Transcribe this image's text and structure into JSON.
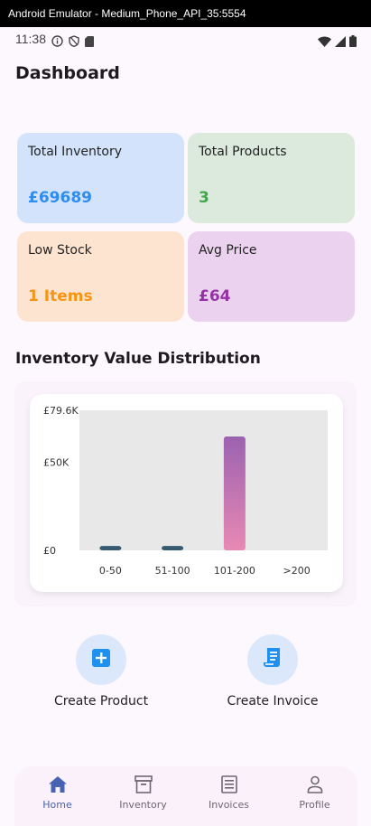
{
  "window": {
    "title": "Android Emulator - Medium_Phone_API_35:5554"
  },
  "status_bar": {
    "time": "11:38"
  },
  "page": {
    "title": "Dashboard"
  },
  "stats": [
    {
      "label": "Total Inventory",
      "value": "£69689",
      "bg": "#d3e3fc",
      "color": "#2f8df0"
    },
    {
      "label": "Total Products",
      "value": "3",
      "bg": "#dbeadc",
      "color": "#3ea94a"
    },
    {
      "label": "Low Stock",
      "value": "1 Items",
      "bg": "#fde4d1",
      "color": "#f79513"
    },
    {
      "label": "Avg Price",
      "value": "£64",
      "bg": "#ebd2ee",
      "color": "#9631a8"
    }
  ],
  "chart_section": {
    "title": "Inventory Value Distribution"
  },
  "chart_data": {
    "type": "bar",
    "categories": [
      "0-50",
      "51-100",
      "101-200",
      ">200"
    ],
    "values": [
      2500,
      2500,
      64689,
      0
    ],
    "ylim": [
      0,
      79600
    ],
    "yticks": [
      {
        "value": 0,
        "label": "£0"
      },
      {
        "value": 50000,
        "label": "£50K"
      },
      {
        "value": 79600,
        "label": "£79.6K"
      }
    ],
    "plot_background": "#e8e8e8",
    "bar_colors": [
      "#365a72",
      "#365a72",
      "gradient:#9b62b0-#e889b4",
      "#365a72"
    ]
  },
  "actions": [
    {
      "label": "Create Product",
      "icon": "add-box-icon"
    },
    {
      "label": "Create Invoice",
      "icon": "receipt-icon"
    }
  ],
  "nav": [
    {
      "label": "Home",
      "icon": "home-icon",
      "active": true
    },
    {
      "label": "Inventory",
      "icon": "inventory-icon",
      "active": false
    },
    {
      "label": "Invoices",
      "icon": "invoices-icon",
      "active": false
    },
    {
      "label": "Profile",
      "icon": "profile-icon",
      "active": false
    }
  ],
  "colors": {
    "accent": "#4a62b3",
    "action_icon": "#1f8ff0"
  }
}
